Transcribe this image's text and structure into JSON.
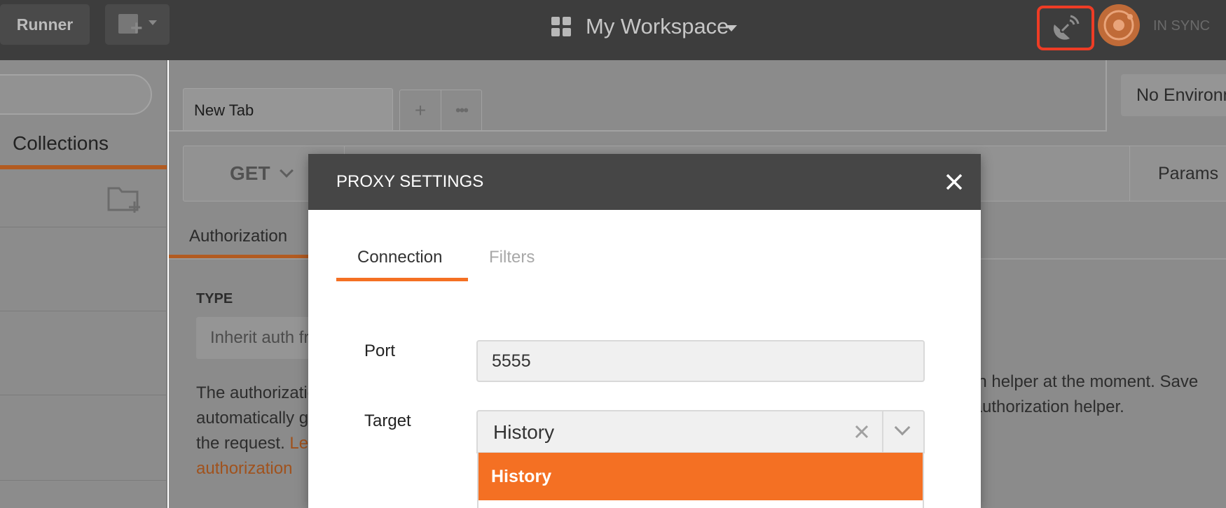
{
  "topbar": {
    "runner_label": "Runner",
    "workspace_title": "My Workspace",
    "sync_status": "IN SYNC",
    "highlight_color": "#ee3c25"
  },
  "sidebar": {
    "collections_label": "Collections"
  },
  "main": {
    "tab_label": "New Tab",
    "new_tab_symbol": "+",
    "more_symbol": "•••",
    "environment_label": "No Environment",
    "method": "GET",
    "params_label": "Params",
    "auth_tab_label": "Authorization",
    "type_label": "TYPE",
    "type_value": "Inherit auth from parent",
    "desc_line1": "The authorization",
    "desc_line2": "automatically g",
    "desc_line3": "the request.",
    "desc_link1": "Le",
    "desc_link2": "authorization",
    "desc_right1": "tion helper at the moment. Save",
    "desc_right2": "s authorization helper."
  },
  "modal": {
    "title": "PROXY SETTINGS",
    "tabs": [
      "Connection",
      "Filters"
    ],
    "port_label": "Port",
    "port_value": "5555",
    "target_label": "Target",
    "target_value": "History",
    "target_options": [
      "History"
    ],
    "accent_color": "#f47023"
  }
}
